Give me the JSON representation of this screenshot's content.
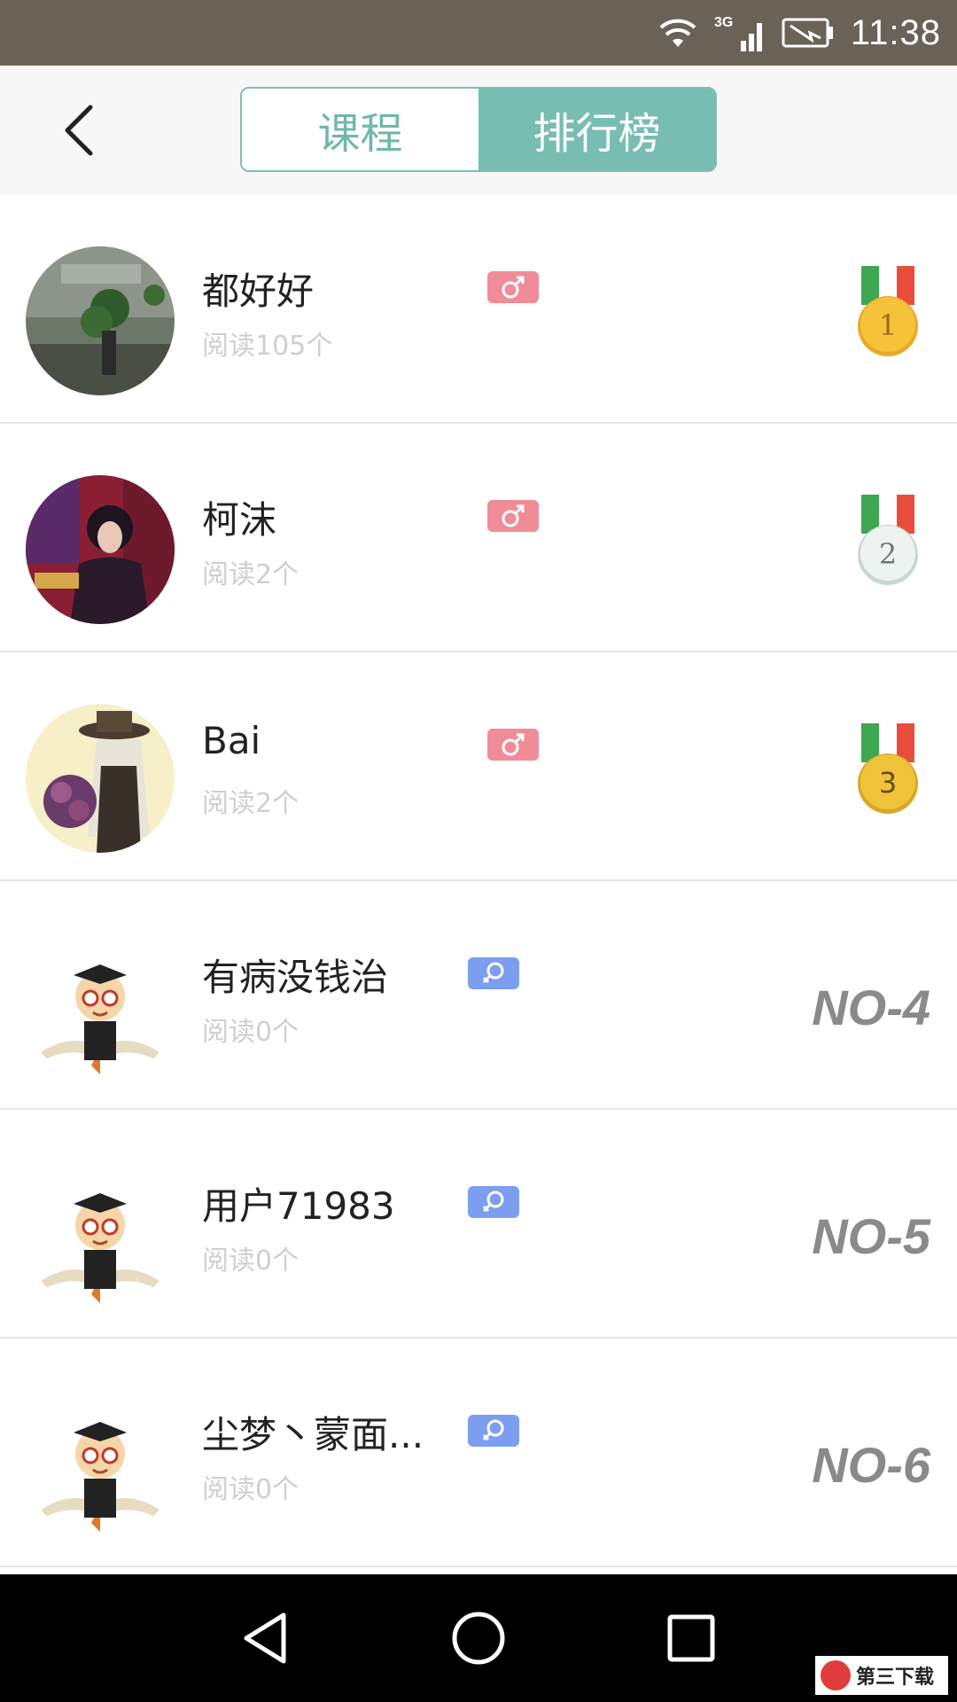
{
  "status_bar": {
    "time": "11:38",
    "network": "3G"
  },
  "header": {
    "tabs": [
      {
        "label": "课程",
        "active": false
      },
      {
        "label": "排行榜",
        "active": true
      }
    ]
  },
  "leaderboard": [
    {
      "name": "都好好",
      "reads": "阅读105个",
      "gender": "male",
      "rank": "1"
    },
    {
      "name": "柯沫",
      "reads": "阅读2个",
      "gender": "male",
      "rank": "2"
    },
    {
      "name": "Bai",
      "reads": "阅读2个",
      "gender": "male",
      "rank": "3"
    },
    {
      "name": "有病没钱治",
      "reads": "阅读0个",
      "gender": "female",
      "rank": "NO-4"
    },
    {
      "name": "用户71983",
      "reads": "阅读0个",
      "gender": "female",
      "rank": "NO-5"
    },
    {
      "name": "尘梦丶蒙面...",
      "reads": "阅读0个",
      "gender": "female",
      "rank": "NO-6"
    }
  ],
  "colors": {
    "accent": "#78bdb2",
    "male": "#f08c98",
    "female": "#7d9ef0",
    "gold": "#f2c12e",
    "silver": "#e8efee"
  },
  "watermark": {
    "text": "第三下载"
  }
}
